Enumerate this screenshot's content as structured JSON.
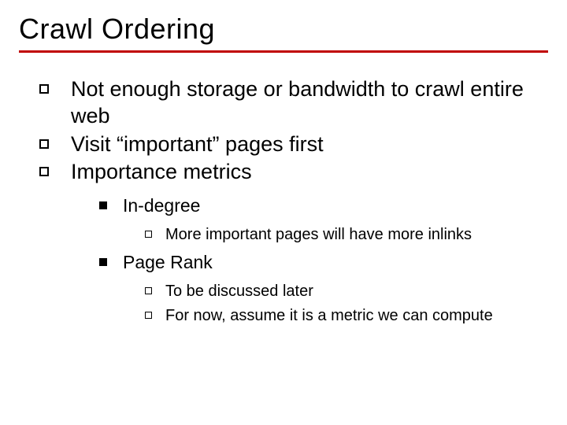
{
  "title": "Crawl Ordering",
  "bullets": {
    "l1": [
      "Not enough storage or bandwidth to crawl entire web",
      "Visit “important” pages first",
      "Importance metrics"
    ],
    "l2": [
      {
        "text": "In-degree",
        "sub": [
          "More important pages will have more inlinks"
        ]
      },
      {
        "text": "Page Rank",
        "sub": [
          "To be discussed later",
          "For now, assume it is a metric we can compute"
        ]
      }
    ]
  }
}
